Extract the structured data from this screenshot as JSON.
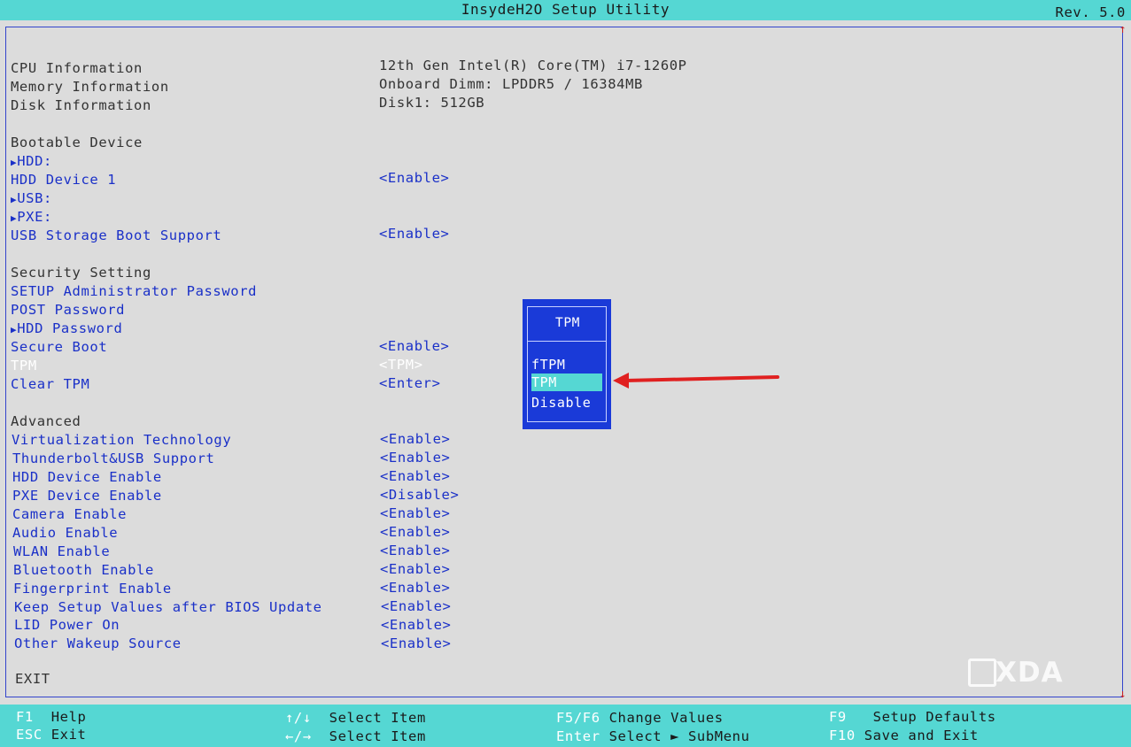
{
  "header": {
    "title": "InsydeH2O Setup Utility",
    "revision": "Rev. 5.0"
  },
  "info": [
    {
      "label": "CPU Information",
      "value": "12th Gen Intel(R) Core(TM) i7-1260P"
    },
    {
      "label": "Memory Information",
      "value": "Onboard Dimm: LPDDR5 / 16384MB"
    },
    {
      "label": "Disk Information",
      "value": "Disk1:  512GB"
    }
  ],
  "sections": {
    "bootable": "Bootable Device",
    "security": "Security Setting",
    "advanced": "Advanced",
    "exit": "EXIT"
  },
  "boot_items": [
    {
      "label": "HDD:",
      "value": ""
    },
    {
      "label": "HDD Device 1",
      "value": "<Enable>"
    },
    {
      "label": "USB:",
      "value": ""
    },
    {
      "label": "PXE:",
      "value": ""
    },
    {
      "label": "USB Storage Boot Support",
      "value": "<Enable>"
    }
  ],
  "security_items": [
    {
      "label": "SETUP Administrator Password",
      "value": ""
    },
    {
      "label": "POST Password",
      "value": ""
    },
    {
      "label": "HDD Password",
      "value": ""
    },
    {
      "label": "Secure Boot",
      "value": "<Enable>"
    },
    {
      "label": "TPM",
      "value": "<TPM>"
    },
    {
      "label": "Clear TPM",
      "value": "<Enter>"
    }
  ],
  "advanced_items": [
    {
      "label": "Virtualization Technology",
      "value": "<Enable>"
    },
    {
      "label": "Thunderbolt&USB Support",
      "value": "<Enable>"
    },
    {
      "label": "HDD Device Enable",
      "value": "<Enable>"
    },
    {
      "label": "PXE Device Enable",
      "value": "<Disable>"
    },
    {
      "label": "Camera Enable",
      "value": "<Enable>"
    },
    {
      "label": "Audio Enable",
      "value": "<Enable>"
    },
    {
      "label": "WLAN Enable",
      "value": "<Enable>"
    },
    {
      "label": "Bluetooth Enable",
      "value": "<Enable>"
    },
    {
      "label": "Fingerprint Enable",
      "value": "<Enable>"
    },
    {
      "label": "Keep Setup Values after BIOS Update",
      "value": "<Enable>"
    },
    {
      "label": "LID Power On",
      "value": "<Enable>"
    },
    {
      "label": "Other Wakeup Source",
      "value": "<Enable>"
    }
  ],
  "popup": {
    "title": "TPM",
    "options": [
      "fTPM",
      "TPM",
      "Disable"
    ],
    "selected": "TPM"
  },
  "watermark": "XDA",
  "help": {
    "f1_key": "F1",
    "f1_label": "Help",
    "esc_key": "ESC",
    "esc_label": "Exit",
    "updown_key": "↑/↓",
    "updown_label": "Select Item",
    "leftright_key": "←/→",
    "leftright_label": "Select Item",
    "f5f6_key": "F5/F6",
    "f5f6_label": "Change Values",
    "enter_key": "Enter",
    "enter_label": "Select ► SubMenu",
    "f9_key": "F9",
    "f9_label": "Setup Defaults",
    "f10_key": "F10",
    "f10_label": "Save and Exit"
  },
  "colors": {
    "accent": "#55d7d3",
    "item_blue": "#1a30c8",
    "popup_blue": "#1a3ad8",
    "background": "#dcdcdc",
    "arrow_red": "#e02020"
  }
}
